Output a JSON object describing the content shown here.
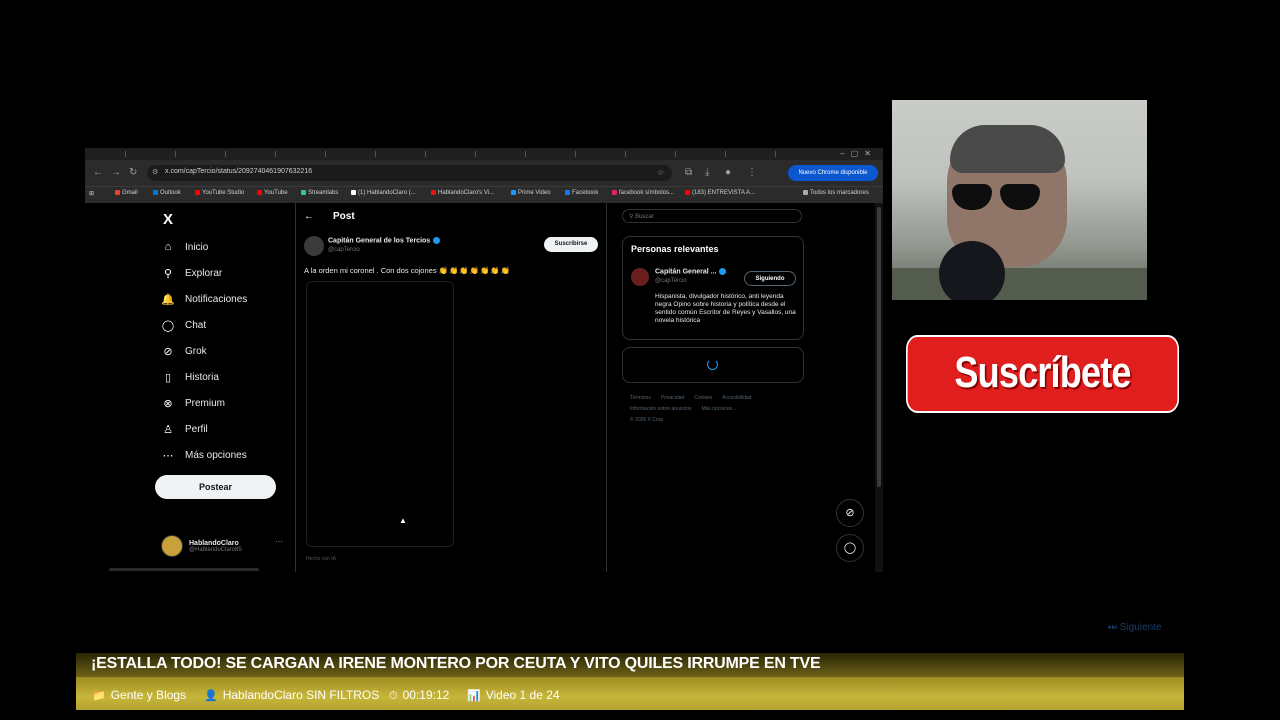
{
  "browser": {
    "url": "x.com/capTercio/status/2092740461907632216",
    "update_button": "Nuevo Chrome disponible",
    "bookmarks": [
      "Gmail",
      "Outlook",
      "YouTube Studio",
      "YouTube",
      "Streamlabs",
      "(1) HablandoClaro (...",
      "HablandoClaro's Vi...",
      "Prime Video",
      "Facebook",
      "facebook símbolos...",
      "(183) ENTREVISTA A...",
      "Todos los marcadores"
    ]
  },
  "x": {
    "logo": "X",
    "nav": [
      {
        "label": "Inicio",
        "icon": "home-icon",
        "glyph": "⌂"
      },
      {
        "label": "Explorar",
        "icon": "search-icon",
        "glyph": "⚲"
      },
      {
        "label": "Notificaciones",
        "icon": "bell-icon",
        "glyph": "🔔"
      },
      {
        "label": "Chat",
        "icon": "chat-icon",
        "glyph": "◯"
      },
      {
        "label": "Grok",
        "icon": "grok-icon",
        "glyph": "⊘"
      },
      {
        "label": "Historia",
        "icon": "bookmark-icon",
        "glyph": "▯"
      },
      {
        "label": "Premium",
        "icon": "premium-icon",
        "glyph": "⊗"
      },
      {
        "label": "Perfil",
        "icon": "profile-icon",
        "glyph": "♙"
      },
      {
        "label": "Más opciones",
        "icon": "more-icon",
        "glyph": "⋯"
      }
    ],
    "post_button": "Postear",
    "account": {
      "name": "HablandoClaro",
      "handle": "@HablandoClaro85",
      "more": "···"
    },
    "post": {
      "header": "Post",
      "author_name": "Capitán General de los Tercios",
      "author_handle": "@capTercio",
      "subscribe": "Suscribirse",
      "text": "A la orden mi coronel . Con dos cojones",
      "emojis": "👏👏👏👏👏👏👏",
      "made_with": "Hecho con IA"
    },
    "search_placeholder": "Buscar",
    "relevant": {
      "title": "Personas relevantes",
      "name": "Capitán General ...",
      "handle": "@capTercio",
      "follow_state": "Siguiendo",
      "bio": "Hispanista, divulgador histórico, anti leyenda negra Opino sobre historia y política desde el sentido común Escritor de Reyes y Vasallos, una novela histórica"
    },
    "footer_links": [
      "Términos",
      "Privacidad",
      "Cookies",
      "Accesibilidad",
      "Información sobre anuncios",
      "Más opciones ...",
      "© 2026 X Corp."
    ]
  },
  "overlay": {
    "subscribe_text": "Suscríbete",
    "next_label": "⏭ Siguiente"
  },
  "video": {
    "title": "¡ESTALLA TODO! SE CARGAN A IRENE MONTERO POR CEUTA Y VITO QUILES IRRUMPE EN TVE",
    "category": "Gente y Blogs",
    "channel": "HablandoClaro SIN FILTROS",
    "duration": "00:19:12",
    "position": "Video 1 de 24"
  },
  "colors": {
    "accent": "#1d9bf0",
    "subscribe_red": "#e01e1e",
    "bar_gold": "#c8b63a"
  }
}
